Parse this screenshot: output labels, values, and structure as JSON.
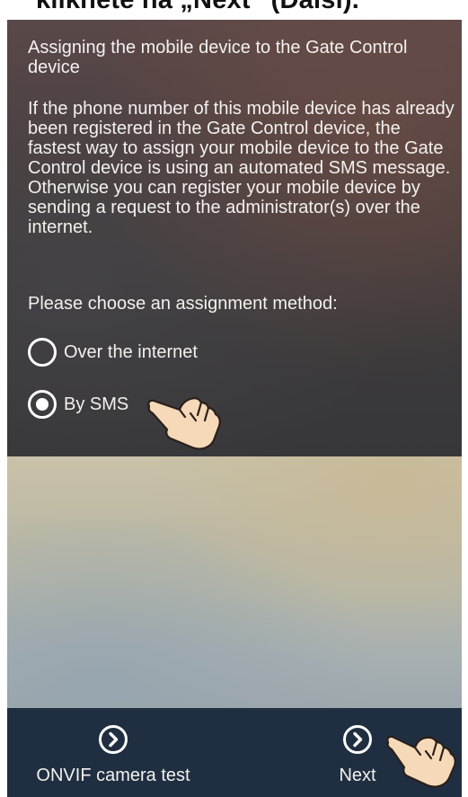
{
  "caption": {
    "text": "kliknete na „Next“ (Další)."
  },
  "screen": {
    "title": "Assigning the mobile device to the Gate Control device",
    "description": "If the phone number of this mobile device has already been registered in the Gate Control device, the fastest way to assign your mobile device to the Gate Control device is using an automated SMS message. Otherwise you can register your mobile device by sending a request to the administrator(s) over the internet.",
    "prompt": "Please choose an assignment method:",
    "options": [
      {
        "label": "Over the internet",
        "selected": false
      },
      {
        "label": "By SMS",
        "selected": true
      }
    ]
  },
  "footer": {
    "onvif_label": "ONVIF camera test",
    "next_label": "Next",
    "icon": "chevron-right-circle-icon",
    "background": "#1f2f41"
  },
  "overlays": {
    "pointer_icon": "hand-pointer-icon"
  }
}
